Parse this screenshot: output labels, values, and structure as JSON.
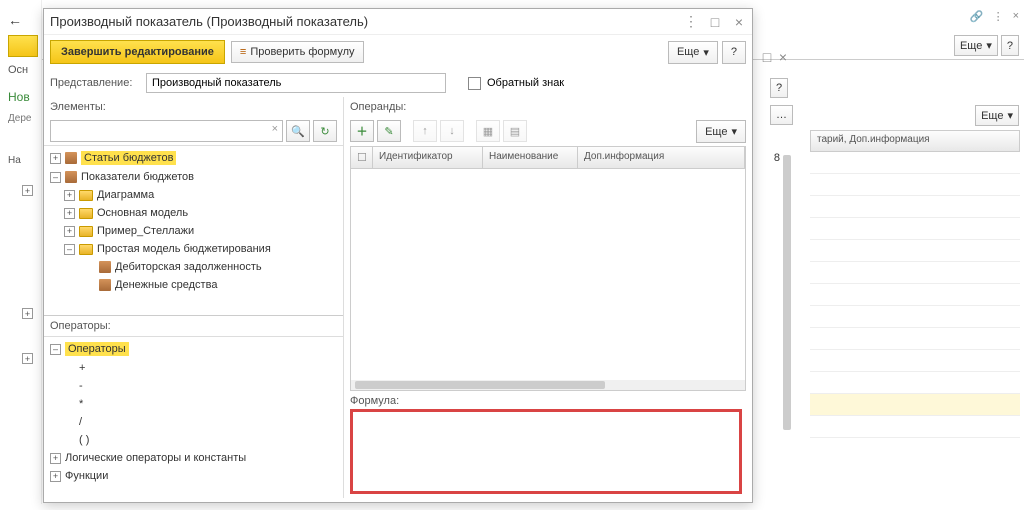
{
  "far_window": {
    "more_label": "Еще",
    "help_label": "?"
  },
  "right_column": {
    "header": "тарий, Доп.информация"
  },
  "mini_num": "8",
  "left_peek": {
    "tab": "Осн",
    "back": "←",
    "new_label": "Нов",
    "tree_label": "Дере",
    "na_label": "На"
  },
  "dialog": {
    "title": "Производный показатель (Производный показатель)",
    "finish_edit": "Завершить редактирование",
    "check_formula": "Проверить формулу",
    "more": "Еще",
    "help": "?",
    "representation_label": "Представление:",
    "representation_value": "Производный показатель",
    "reverse_sign": "Обратный знак",
    "elements_label": "Элементы:",
    "operands_label": "Операнды:",
    "operators_label": "Операторы:",
    "formula_label": "Формула:",
    "tree": {
      "budget_articles": "Статьи бюджетов",
      "budget_indicators": "Показатели бюджетов",
      "diagram": "Диаграмма",
      "main_model": "Основная модель",
      "example_racks": "Пример_Стеллажи",
      "simple_model": "Простая модель бюджетирования",
      "receivables": "Дебиторская задолженность",
      "cash": "Денежные средства"
    },
    "operators": {
      "root": "Операторы",
      "plus": "+",
      "minus": "-",
      "mult": "*",
      "div": "/",
      "paren": "( )",
      "logical": "Логические операторы и константы",
      "functions": "Функции"
    },
    "grid_cols": {
      "id": "Идентификатор",
      "name": "Наименование",
      "extra": "Доп.информация"
    }
  }
}
